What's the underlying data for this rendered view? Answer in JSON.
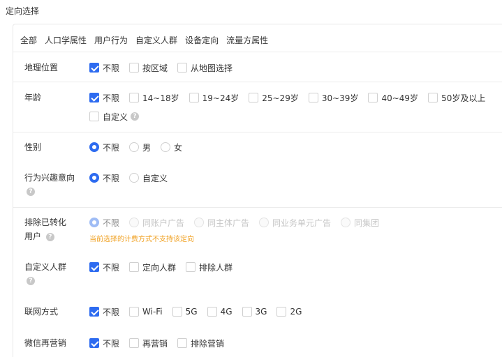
{
  "section_title": "定向选择",
  "tabs": [
    "全部",
    "人口学属性",
    "用户行为",
    "自定义人群",
    "设备定向",
    "流量方属性"
  ],
  "rows": {
    "location": {
      "label": "地理位置",
      "options": [
        "不限",
        "按区域",
        "从地图选择"
      ]
    },
    "age": {
      "label": "年龄",
      "options": [
        "不限",
        "14~18岁",
        "19~24岁",
        "25~29岁",
        "30~39岁",
        "40~49岁",
        "50岁及以上"
      ],
      "custom": "自定义"
    },
    "gender": {
      "label": "性别",
      "options": [
        "不限",
        "男",
        "女"
      ]
    },
    "interest": {
      "label": "行为兴趣意向",
      "options": [
        "不限",
        "自定义"
      ]
    },
    "exclude": {
      "label_line1": "排除已转化",
      "label_line2": "用户",
      "options": [
        "不限",
        "同账户广告",
        "同主体广告",
        "同业务单元广告",
        "同集团"
      ],
      "warning": "当前选择的计费方式不支持该定向"
    },
    "audience": {
      "label": "自定义人群",
      "options": [
        "不限",
        "定向人群",
        "排除人群"
      ]
    },
    "network": {
      "label": "联网方式",
      "options": [
        "不限",
        "Wi-Fi",
        "5G",
        "4G",
        "3G",
        "2G"
      ]
    },
    "wechat": {
      "label": "微信再营销",
      "options": [
        "不限",
        "再营销",
        "排除营销"
      ]
    }
  },
  "help_icon_glyph": "?",
  "colors": {
    "accent": "#2d6bf0",
    "warning": "#f0a020",
    "disabled": "#c6c6c6"
  }
}
